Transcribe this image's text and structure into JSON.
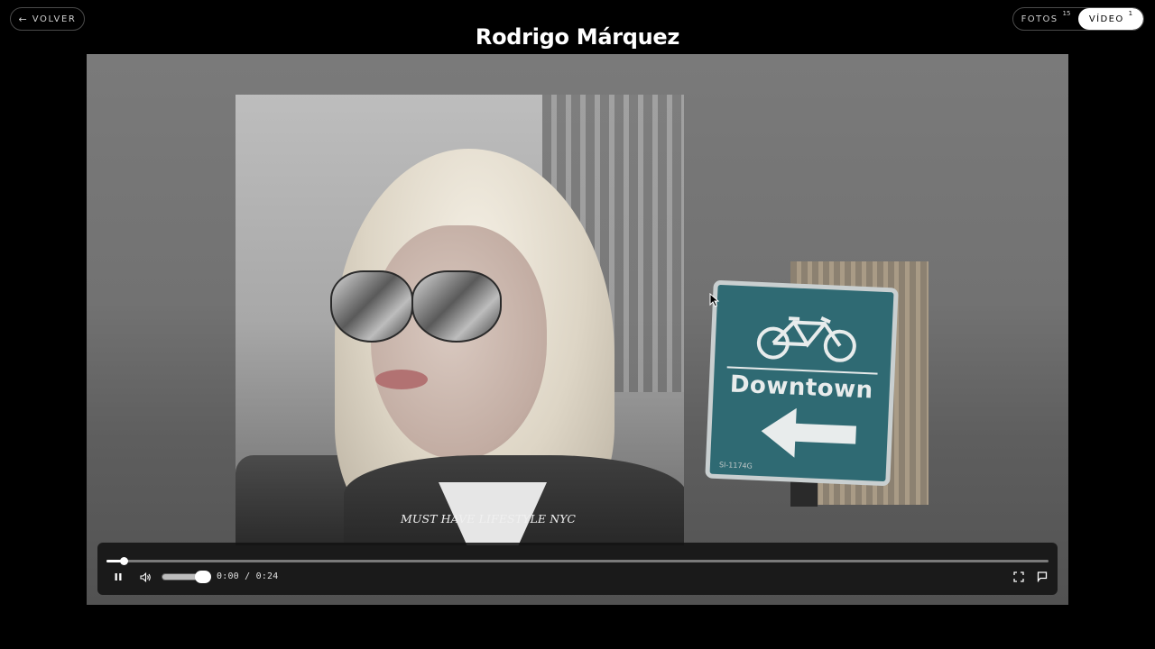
{
  "nav": {
    "back_arrow": "←",
    "back_label": "VOLVER"
  },
  "header": {
    "title": "Rodrigo Márquez"
  },
  "media_toggle": {
    "fotos_label": "FOTOS",
    "fotos_count": "15",
    "video_label": "VÍDEO",
    "video_count": "1",
    "selected": "video"
  },
  "video": {
    "caption": "MUST HAVE LIFESTYLE NYC",
    "sign_text": "Downtown",
    "sign_code": "SI-1174G",
    "progress_fraction": 0.018,
    "volume_fraction": 1.0,
    "current_time": "0:00",
    "time_separator": "/",
    "duration": "0:24"
  },
  "icons": {
    "pause": "pause-icon",
    "volume": "speaker-icon",
    "fullscreen": "fullscreen-icon",
    "feedback": "flag-icon"
  },
  "colors": {
    "background": "#000000",
    "sign_teal": "#2f6a73",
    "toggle_active_bg": "#ffffff"
  }
}
